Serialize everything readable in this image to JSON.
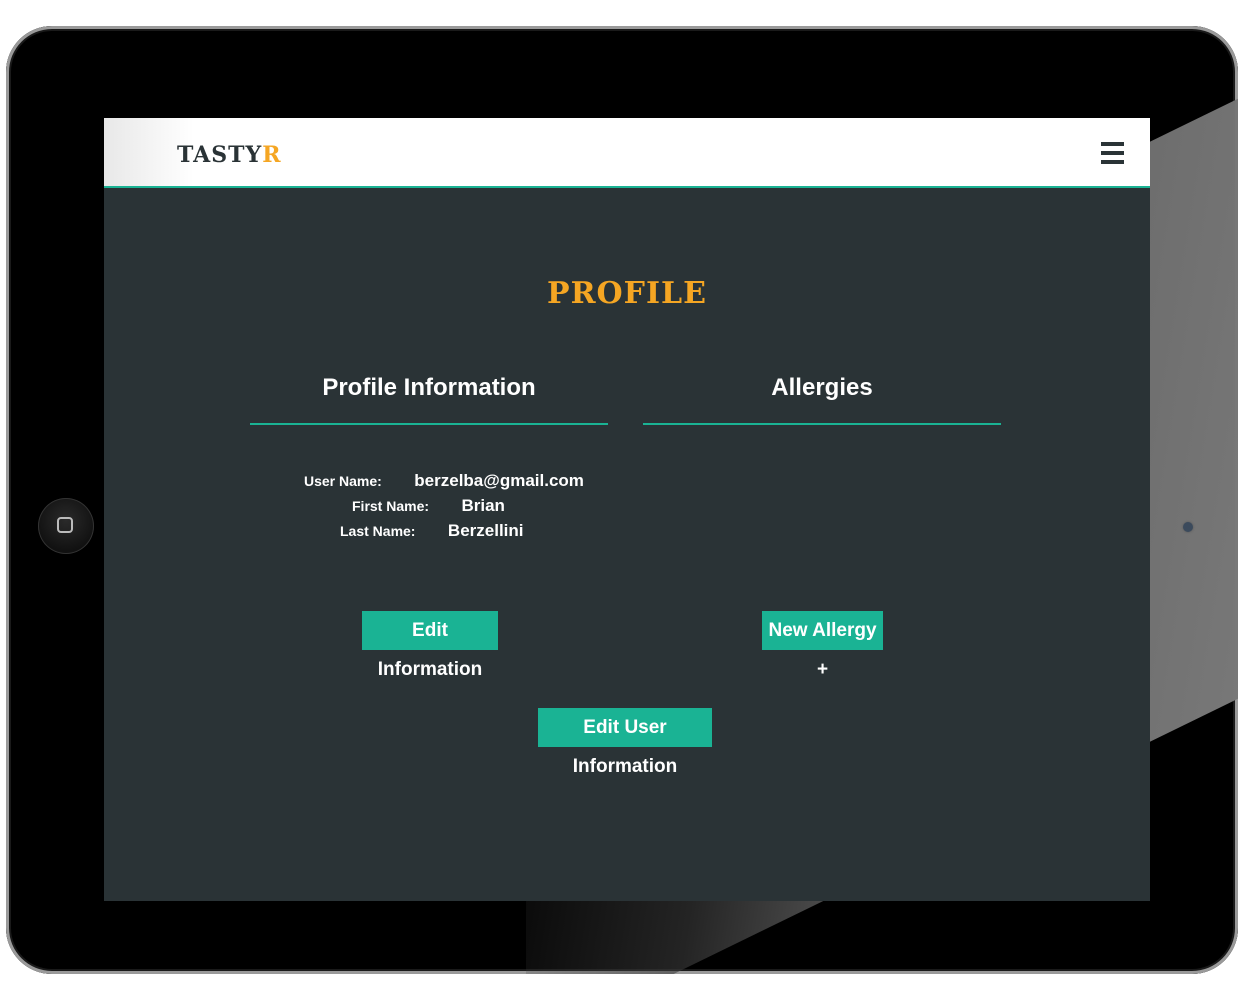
{
  "app": {
    "brand_main": "TASTY",
    "brand_accent": "R"
  },
  "header": {
    "menu_icon": "hamburger-menu-icon"
  },
  "page": {
    "title": "PROFILE"
  },
  "profile_section": {
    "heading": "Profile Information",
    "fields": [
      {
        "label": "User Name:",
        "value": "berzelba@gmail.com"
      },
      {
        "label": "First Name:",
        "value": "Brian"
      },
      {
        "label": "Last Name:",
        "value": "Berzellini"
      }
    ],
    "edit_button": "Edit Information"
  },
  "allergies_section": {
    "heading": "Allergies",
    "new_button": "New Allergy +"
  },
  "edit_user_button": "Edit User Information",
  "colors": {
    "accent": "#1ab394",
    "brand": "#f5a623",
    "background": "#2a3336"
  }
}
